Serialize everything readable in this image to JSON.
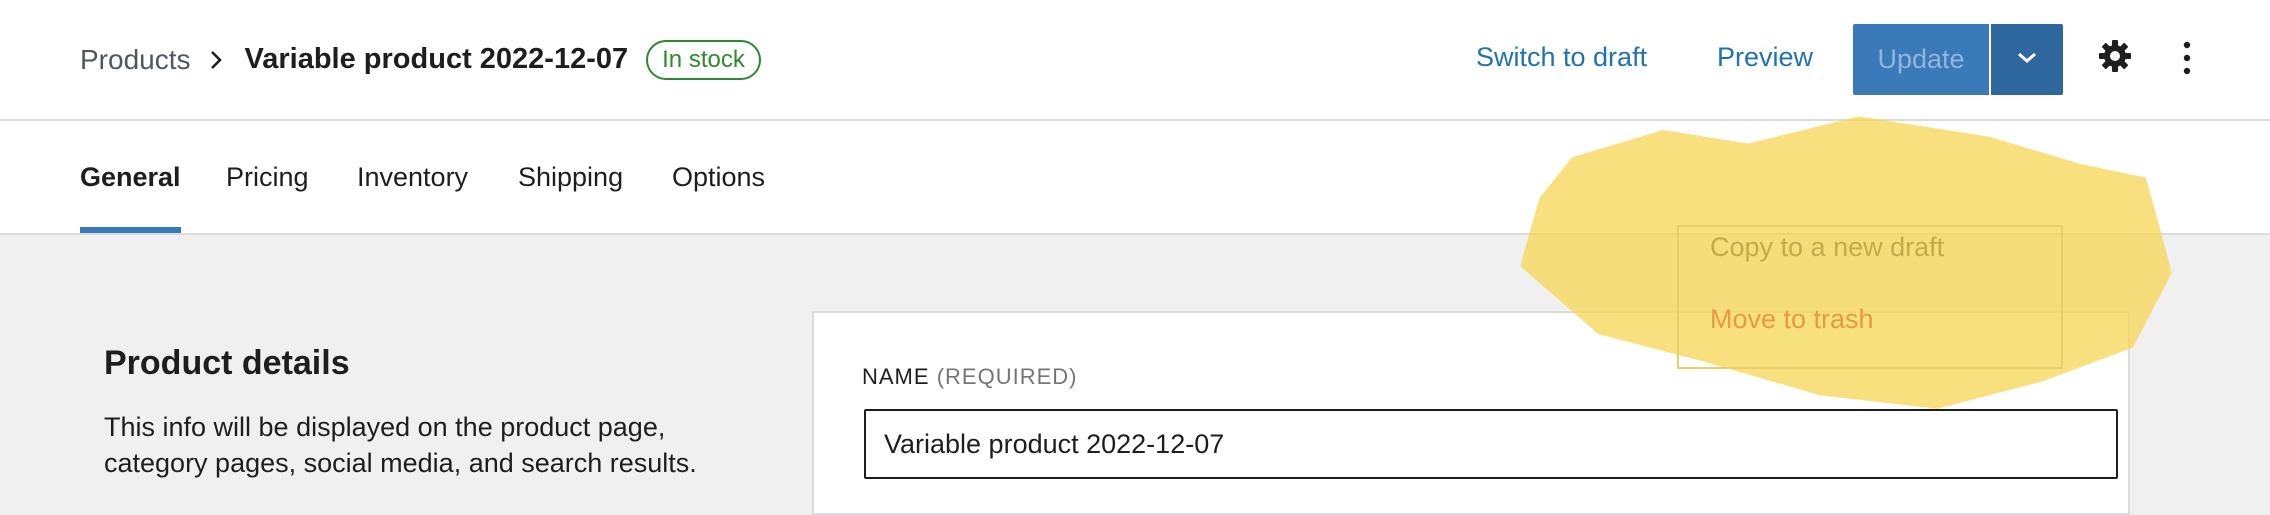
{
  "header": {
    "breadcrumb_parent": "Products",
    "title": "Variable product 2022-12-07",
    "status_badge": "In stock",
    "actions": {
      "switch_to_draft": "Switch to draft",
      "preview": "Preview",
      "update": "Update"
    }
  },
  "tabs": [
    {
      "label": "General",
      "active": true
    },
    {
      "label": "Pricing",
      "active": false
    },
    {
      "label": "Inventory",
      "active": false
    },
    {
      "label": "Shipping",
      "active": false
    },
    {
      "label": "Options",
      "active": false
    }
  ],
  "update_menu": {
    "items": [
      {
        "label": "Copy to a new draft"
      },
      {
        "label": "Move to trash"
      }
    ]
  },
  "section": {
    "title": "Product details",
    "description": "This info will be displayed on the product page, category pages, social media, and search results."
  },
  "form": {
    "name_label": "NAME",
    "name_required": "(REQUIRED)",
    "name_value": "Variable product 2022-12-07"
  },
  "colors": {
    "accent": "#2271b1",
    "status_green": "#2e8a2e",
    "highlight": "#f6d85a"
  },
  "icons": [
    "chevron-right-icon",
    "chevron-down-icon",
    "gear-icon",
    "more-vertical-icon"
  ]
}
